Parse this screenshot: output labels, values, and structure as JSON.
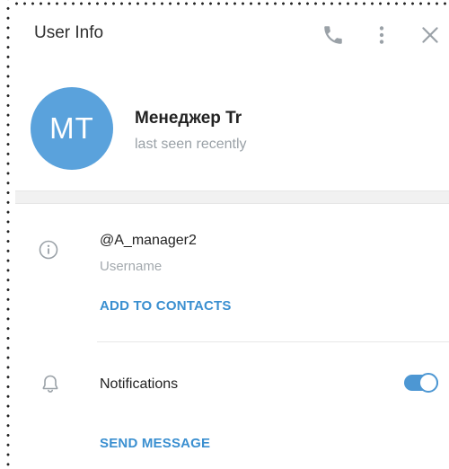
{
  "header": {
    "title": "User Info",
    "icons": [
      "phone-icon",
      "more-vertical-icon",
      "close-icon"
    ]
  },
  "profile": {
    "initials": "MT",
    "name": "Менеджер Tr",
    "status": "last seen recently",
    "avatar_color": "#5aa2dc"
  },
  "info": {
    "username": "@A_manager2",
    "username_label": "Username",
    "add_contacts": "ADD TO CONTACTS"
  },
  "notifications": {
    "label": "Notifications",
    "enabled": true,
    "send_message": "SEND MESSAGE"
  },
  "colors": {
    "accent": "#3a8fd0",
    "toggle": "#4d97d3"
  }
}
